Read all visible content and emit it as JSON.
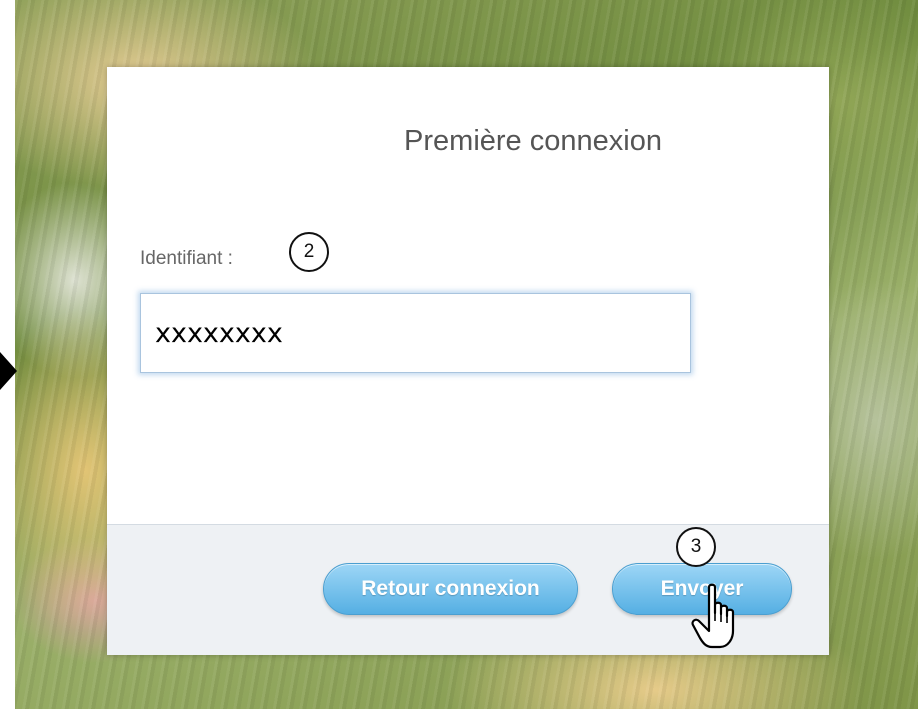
{
  "dialog": {
    "title": "Première connexion",
    "field_label": "Identifiant :",
    "identifier_value": "xxxxxxxx",
    "back_button_label": "Retour connexion",
    "send_button_label": "Envoyer"
  },
  "annotations": {
    "marker_2": "2",
    "marker_3": "3"
  },
  "icons": {
    "cursor": "hand-pointer-icon",
    "left_arrow": "arrow-right-icon"
  },
  "colors": {
    "button_top": "#9dd6f6",
    "button_bottom": "#55afe3",
    "footer_background": "#eef1f4",
    "input_focus_glow": "#a9c4de"
  }
}
